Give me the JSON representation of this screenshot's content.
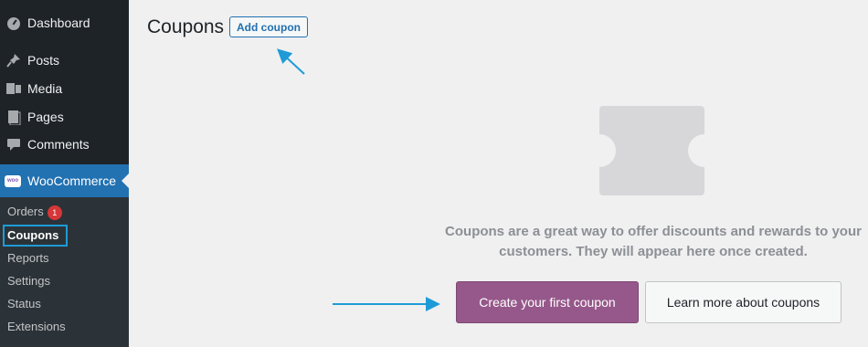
{
  "sidebar": {
    "items": [
      {
        "label": "Dashboard",
        "icon": "dashboard-icon"
      },
      {
        "label": "Posts",
        "icon": "pin-icon"
      },
      {
        "label": "Media",
        "icon": "media-icon"
      },
      {
        "label": "Pages",
        "icon": "pages-icon"
      },
      {
        "label": "Comments",
        "icon": "comment-icon"
      }
    ],
    "woocommerce": {
      "label": "WooCommerce",
      "logo_text": "woo"
    },
    "submenu": [
      {
        "label": "Orders",
        "badge": "1"
      },
      {
        "label": "Coupons"
      },
      {
        "label": "Reports"
      },
      {
        "label": "Settings"
      },
      {
        "label": "Status"
      },
      {
        "label": "Extensions"
      }
    ]
  },
  "header": {
    "title": "Coupons",
    "add_button": "Add coupon"
  },
  "empty_state": {
    "message": "Coupons are a great way to offer discounts and rewards to your customers. They will appear here once created.",
    "primary_button": "Create your first coupon",
    "secondary_button": "Learn more about coupons"
  },
  "colors": {
    "sidebar_bg": "#1d2327",
    "active_menu": "#2271b1",
    "primary_button": "#96588a",
    "annotation": "#1e9bd7",
    "badge": "#d63638"
  }
}
